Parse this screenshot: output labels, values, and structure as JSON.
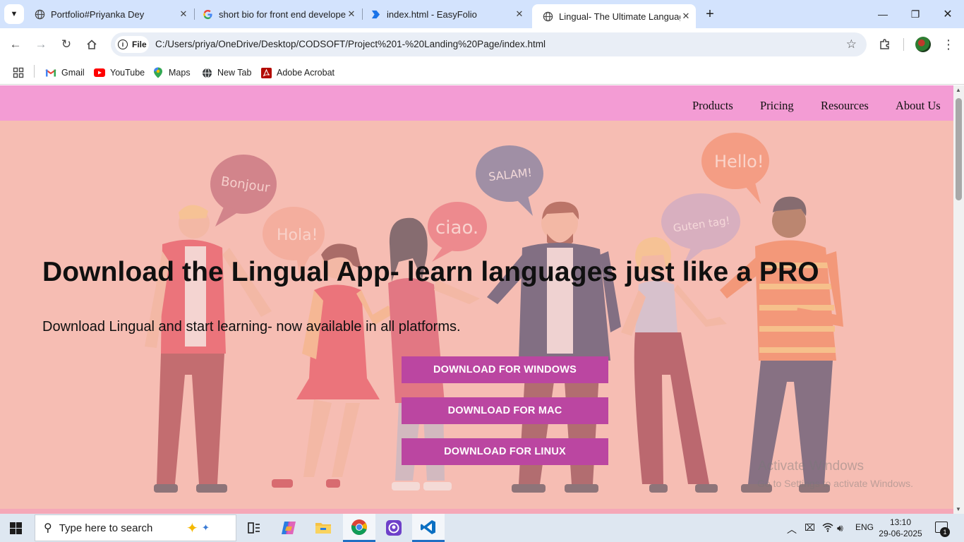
{
  "browser": {
    "tabs": [
      {
        "title": "Portfolio#Priyanka Dey",
        "icon": "globe-icon",
        "active": false
      },
      {
        "title": "short bio for front end developer",
        "icon": "google-icon",
        "active": false
      },
      {
        "title": "index.html - EasyFolio",
        "icon": "easyfolio-icon",
        "active": false
      },
      {
        "title": "Lingual- The Ultimate Language",
        "icon": "globe-icon",
        "active": true
      }
    ],
    "address_chip": "File",
    "url": "C:/Users/priya/OneDrive/Desktop/CODSOFT/Project%201-%20Landing%20Page/index.html",
    "bookmarks": [
      {
        "label": "Gmail",
        "icon": "gmail-icon"
      },
      {
        "label": "YouTube",
        "icon": "youtube-icon"
      },
      {
        "label": "Maps",
        "icon": "maps-icon"
      },
      {
        "label": "New Tab",
        "icon": "globe-icon"
      },
      {
        "label": "Adobe Acrobat",
        "icon": "acrobat-icon"
      }
    ]
  },
  "page": {
    "nav": [
      "Products",
      "Pricing",
      "Resources",
      "About Us"
    ],
    "hero": {
      "title": "Download the Lingual App- learn languages just like a PRO",
      "subtitle": "Download Lingual and start learning- now available in all platforms.",
      "buttons": [
        "DOWNLOAD FOR WINDOWS",
        "DOWNLOAD FOR MAC",
        "DOWNLOAD FOR LINUX"
      ],
      "speech_bubbles": [
        "Bonjour",
        "Hola!",
        "ciao.",
        "SALAM!",
        "Guten tag!",
        "Hello!"
      ]
    },
    "watermark": {
      "line1": "Activate Windows",
      "line2": "Go to Settings to activate Windows."
    }
  },
  "taskbar": {
    "search_placeholder": "Type here to search",
    "apps": [
      "task-view-icon",
      "copilot-icon",
      "file-explorer-icon",
      "chrome-icon",
      "github-desktop-icon",
      "vscode-icon"
    ],
    "language": "ENG",
    "time": "13:10",
    "date": "29-06-2025",
    "notification_count": "1"
  },
  "colors": {
    "navbar": "#f39cd4",
    "hero_bg": "#f6bdb3",
    "button": "#bb46a1",
    "tabstrip": "#d3e3fd"
  }
}
